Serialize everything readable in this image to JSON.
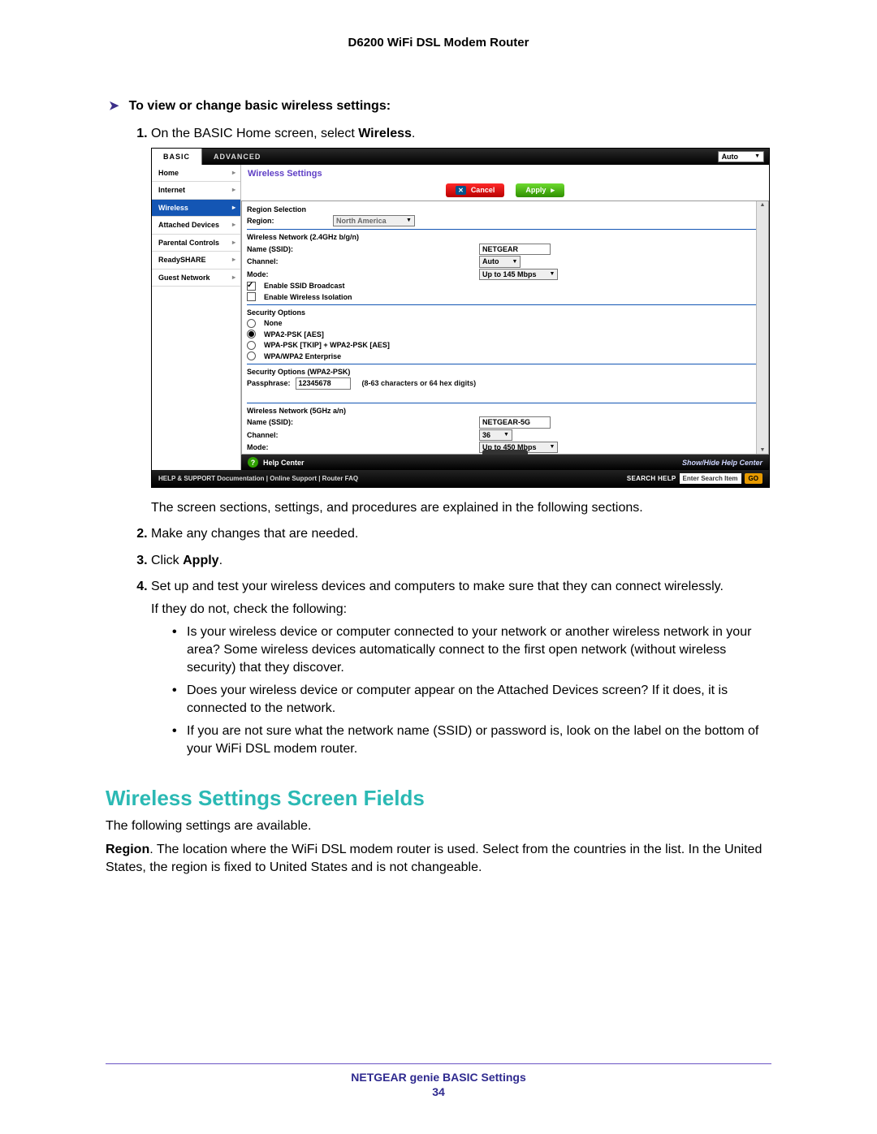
{
  "doc": {
    "title": "D6200 WiFi DSL Modem Router",
    "lead": "To view or change basic wireless settings:",
    "step1_pre": "On the BASIC Home screen, select ",
    "step1_bold": "Wireless",
    "step1_post": ".",
    "after_shot": "The screen sections, settings, and procedures are explained in the following sections.",
    "step2": "Make any changes that are needed.",
    "step3_pre": "Click ",
    "step3_bold": "Apply",
    "step3_post": ".",
    "step4": "Set up and test your wireless devices and computers to make sure that they can connect wirelessly.",
    "check_intro": "If they do not, check the following:",
    "bullets": [
      "Is your wireless device or computer connected to your network or another wireless network in your area? Some wireless devices automatically connect to the first open network (without wireless security) that they discover.",
      "Does your wireless device or computer appear on the Attached Devices screen? If it does, it is connected to the network.",
      "If you are not sure what the network name (SSID) or password is, look on the label on the bottom of your WiFi DSL modem router."
    ],
    "h2": "Wireless Settings Screen Fields",
    "p1": "The following settings are available.",
    "p2_label": "Region",
    "p2_text": ". The location where the WiFi DSL modem router is used. Select from the countries in the list. In the United States, the region is fixed to United States and is not changeable."
  },
  "footer": {
    "title": "NETGEAR genie BASIC Settings",
    "page": "34"
  },
  "shot": {
    "tabs": {
      "basic": "BASIC",
      "advanced": "ADVANCED"
    },
    "autoselect": "Auto",
    "side": [
      "Home",
      "Internet",
      "Wireless",
      "Attached Devices",
      "Parental Controls",
      "ReadySHARE",
      "Guest Network"
    ],
    "panel_title": "Wireless Settings",
    "btn_cancel": "Cancel",
    "btn_apply": "Apply",
    "region_head": "Region Selection",
    "region_label": "Region:",
    "region_value": "North America",
    "n24": {
      "head": "Wireless Network (2.4GHz b/g/n)",
      "ssid_l": "Name (SSID):",
      "ssid_v": "NETGEAR",
      "ch_l": "Channel:",
      "ch_v": "Auto",
      "mode_l": "Mode:",
      "mode_v": "Up to 145 Mbps",
      "opt1": "Enable SSID Broadcast",
      "opt2": "Enable Wireless Isolation"
    },
    "sec": {
      "head": "Security Options",
      "r1": "None",
      "r2": "WPA2-PSK [AES]",
      "r3": "WPA-PSK [TKIP] + WPA2-PSK [AES]",
      "r4": "WPA/WPA2 Enterprise",
      "psk_head": "Security Options (WPA2-PSK)",
      "pass_l": "Passphrase:",
      "pass_v": "12345678",
      "pass_hint": "(8-63 characters or 64 hex digits)"
    },
    "n5": {
      "head": "Wireless Network (5GHz a/n)",
      "ssid_l": "Name (SSID):",
      "ssid_v": "NETGEAR-5G",
      "ch_l": "Channel:",
      "ch_v": "36",
      "mode_l": "Mode:",
      "mode_v": "Up to 450 Mbps"
    },
    "helpcenter": "Help Center",
    "showhide": "Show/Hide Help Center",
    "support_left": "HELP & SUPPORT  Documentation  |  Online Support  |  Router FAQ",
    "search_label": "SEARCH HELP",
    "search_ph": "Enter Search Item",
    "go": "GO"
  }
}
